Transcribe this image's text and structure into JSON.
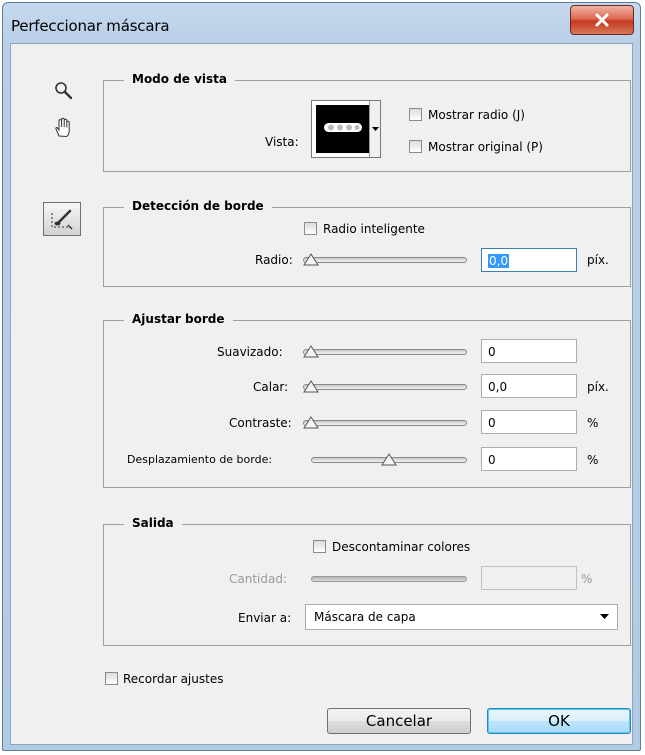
{
  "window": {
    "title": "Perfeccionar máscara"
  },
  "icons": {
    "zoom": "magnifier-icon",
    "hand": "hand-icon",
    "refine_radius": "refine-radius-brush-icon",
    "close": "close-icon"
  },
  "view_mode": {
    "legend": "Modo de vista",
    "view_label": "Vista:",
    "show_radius": "Mostrar radio (J)",
    "show_original": "Mostrar original (P)"
  },
  "edge_detection": {
    "legend": "Detección de borde",
    "smart_radius": "Radio inteligente",
    "radius_label": "Radio:",
    "radius_value": "0,0",
    "radius_unit": "píx."
  },
  "adjust_edge": {
    "legend": "Ajustar borde",
    "rows": [
      {
        "label": "Suavizado:",
        "value": "0",
        "unit": ""
      },
      {
        "label": "Calar:",
        "value": "0,0",
        "unit": "píx."
      },
      {
        "label": "Contraste:",
        "value": "0",
        "unit": "%"
      },
      {
        "label": "Desplazamiento de borde:",
        "value": "0",
        "unit": "%"
      }
    ]
  },
  "output": {
    "legend": "Salida",
    "decontaminate": "Descontaminar colores",
    "amount_label": "Cantidad:",
    "amount_value": "",
    "amount_unit": "%",
    "send_to_label": "Enviar a:",
    "send_to_value": "Máscara de capa"
  },
  "remember": "Recordar ajustes",
  "buttons": {
    "cancel": "Cancelar",
    "ok": "OK"
  },
  "colors": {
    "title_bar": "#b9cfe7",
    "dialog_bg": "#f0f0f0",
    "close": "#c5391e",
    "selection": "#3399ff"
  }
}
